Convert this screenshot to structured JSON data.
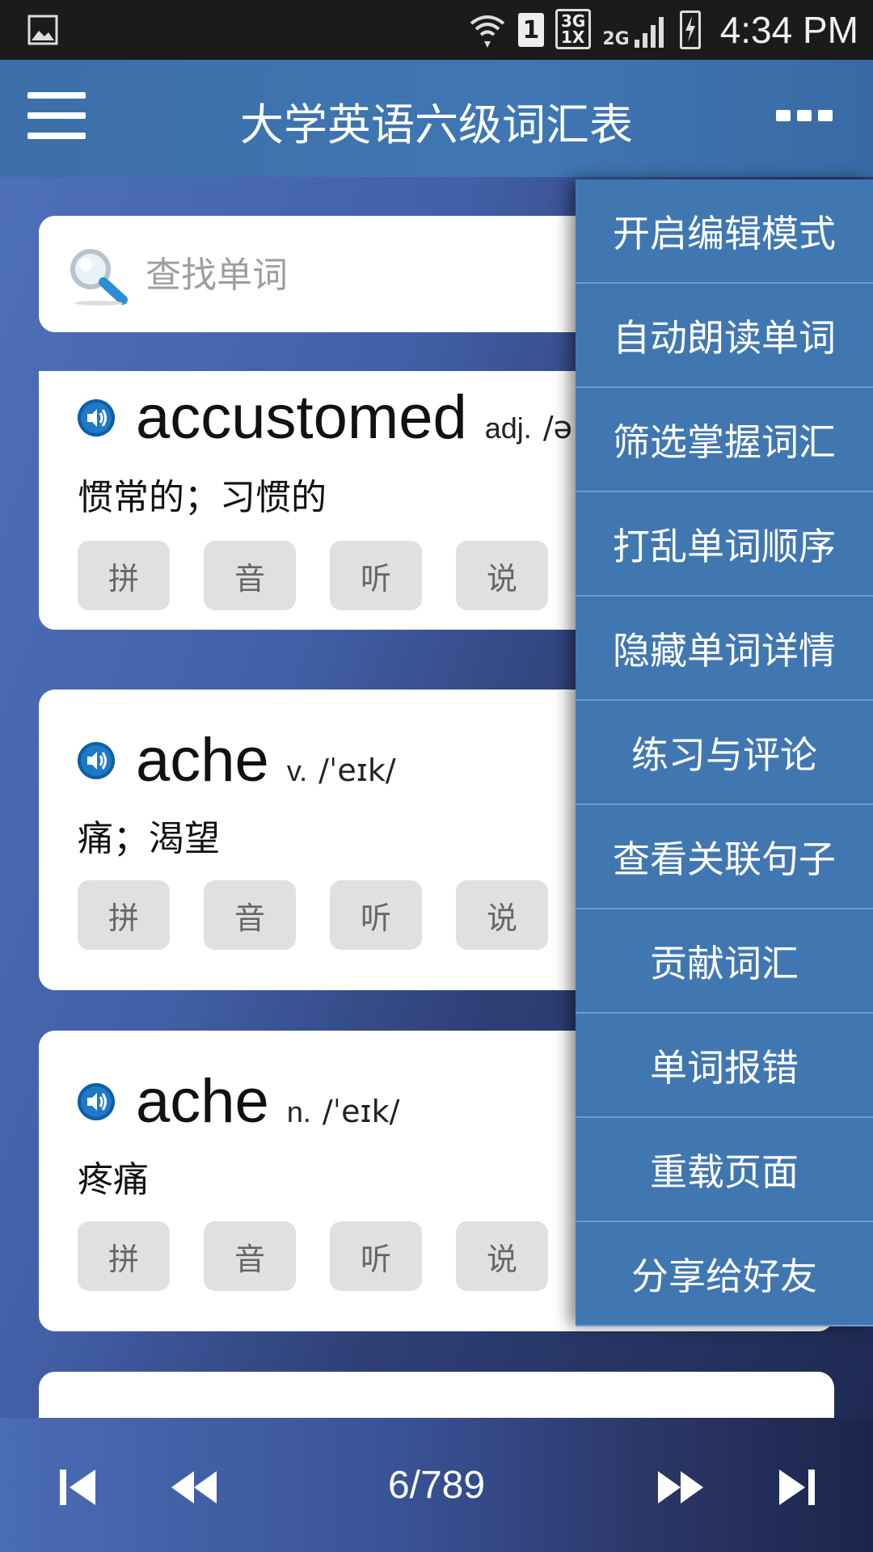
{
  "status_bar": {
    "time": "4:34 PM",
    "sim": "1",
    "net_top": "3G",
    "net_bottom": "1X",
    "net2": "2G",
    "icons": [
      "picture-icon",
      "wifi-icon",
      "sim-icon",
      "signal-3g-icon",
      "signal-2g-icon",
      "battery-charging-icon"
    ]
  },
  "app_bar": {
    "title": "大学英语六级词汇表",
    "menu_icon": "hamburger-icon",
    "more_icon": "overflow-menu-icon"
  },
  "search": {
    "placeholder": "查找单词",
    "icon": "magnifier-icon"
  },
  "words": [
    {
      "word": "accustomed",
      "pos": "adj.",
      "phonetic": "/ə",
      "meaning": "惯常的；习惯的",
      "buttons": [
        "拼",
        "音",
        "听",
        "说"
      ]
    },
    {
      "word": "ache",
      "pos": "v.",
      "phonetic": "/ˈeɪk/",
      "meaning": "痛；渴望",
      "buttons": [
        "拼",
        "音",
        "听",
        "说"
      ]
    },
    {
      "word": "ache",
      "pos": "n.",
      "phonetic": "/ˈeɪk/",
      "meaning": "疼痛",
      "buttons": [
        "拼",
        "音",
        "听",
        "说"
      ]
    }
  ],
  "menu": {
    "items": [
      "开启编辑模式",
      "自动朗读单词",
      "筛选掌握词汇",
      "打乱单词顺序",
      "隐藏单词详情",
      "练习与评论",
      "查看关联句子",
      "贡献词汇",
      "单词报错",
      "重载页面",
      "分享给好友"
    ]
  },
  "pager": {
    "indicator": "6/789",
    "icons": [
      "skip-first-icon",
      "rewind-icon",
      "fast-forward-icon",
      "skip-last-icon"
    ]
  },
  "colors": {
    "app_bar": "#3f76b3",
    "menu_bg": "#4177b1",
    "speaker": "#1e79c7",
    "status_bar": "#1b1b1b"
  }
}
